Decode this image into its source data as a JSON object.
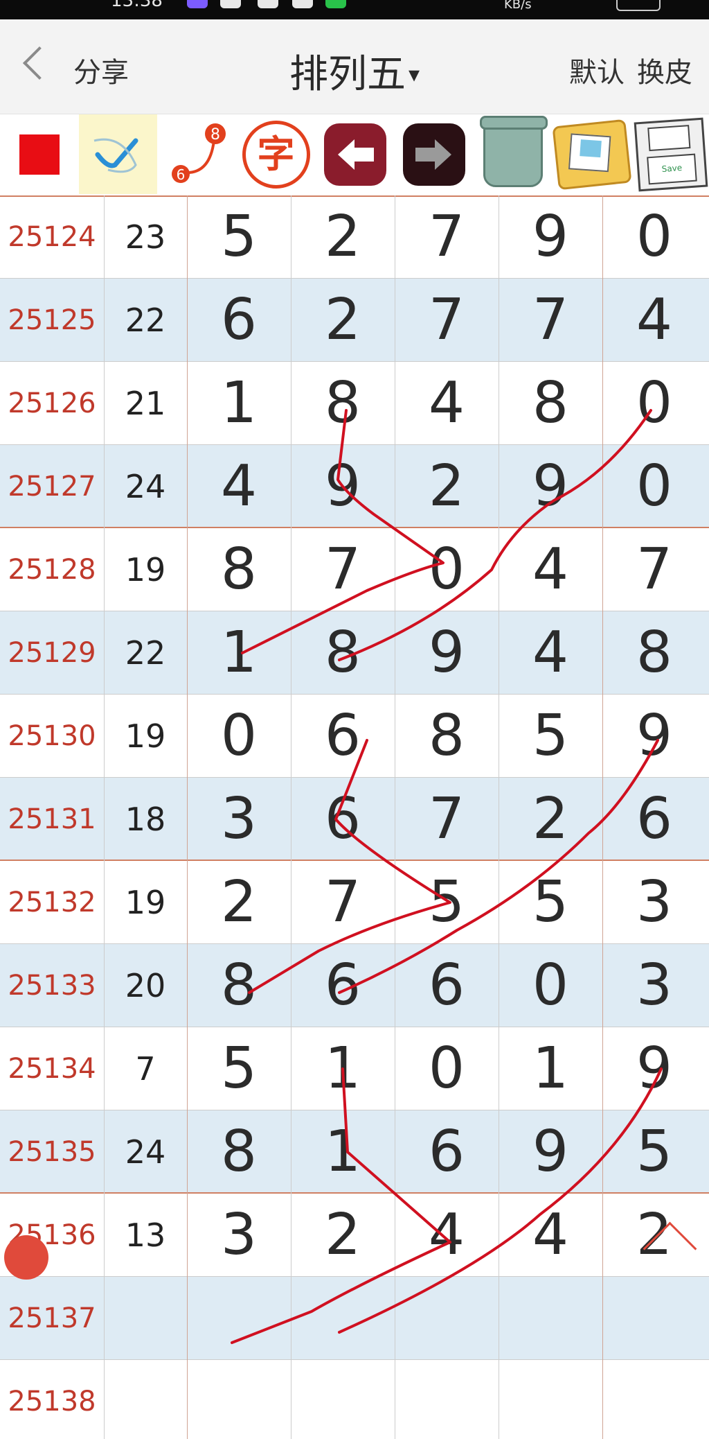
{
  "status_bar": {
    "time": "13:38",
    "network": "KB/s"
  },
  "nav": {
    "back_label": "分享",
    "title": "排列五",
    "title_caret": "▾",
    "default_label": "默认",
    "skin_label": "换皮"
  },
  "toolbar": {
    "tools": [
      {
        "icon": "red-square-icon"
      },
      {
        "icon": "check-scribble-icon"
      },
      {
        "icon": "connect-8-6-icon",
        "badge_top": "8",
        "badge_bottom": "6"
      },
      {
        "icon": "text-char-icon",
        "label": "字"
      },
      {
        "icon": "arrow-left-icon"
      },
      {
        "icon": "arrow-right-icon"
      },
      {
        "icon": "trash-icon"
      },
      {
        "icon": "folder-images-icon"
      },
      {
        "icon": "floppy-disk-icon",
        "label": "Save"
      }
    ]
  },
  "table": {
    "rows": [
      {
        "period": "25124",
        "sum": "23",
        "digits": [
          "5",
          "2",
          "7",
          "9",
          "0"
        ]
      },
      {
        "period": "25125",
        "sum": "22",
        "digits": [
          "6",
          "2",
          "7",
          "7",
          "4"
        ]
      },
      {
        "period": "25126",
        "sum": "21",
        "digits": [
          "1",
          "8",
          "4",
          "8",
          "0"
        ]
      },
      {
        "period": "25127",
        "sum": "24",
        "digits": [
          "4",
          "9",
          "2",
          "9",
          "0"
        ]
      },
      {
        "period": "25128",
        "sum": "19",
        "digits": [
          "8",
          "7",
          "0",
          "4",
          "7"
        ]
      },
      {
        "period": "25129",
        "sum": "22",
        "digits": [
          "1",
          "8",
          "9",
          "4",
          "8"
        ]
      },
      {
        "period": "25130",
        "sum": "19",
        "digits": [
          "0",
          "6",
          "8",
          "5",
          "9"
        ]
      },
      {
        "period": "25131",
        "sum": "18",
        "digits": [
          "3",
          "6",
          "7",
          "2",
          "6"
        ]
      },
      {
        "period": "25132",
        "sum": "19",
        "digits": [
          "2",
          "7",
          "5",
          "5",
          "3"
        ]
      },
      {
        "period": "25133",
        "sum": "20",
        "digits": [
          "8",
          "6",
          "6",
          "0",
          "3"
        ]
      },
      {
        "period": "25134",
        "sum": "7",
        "digits": [
          "5",
          "1",
          "0",
          "1",
          "9"
        ]
      },
      {
        "period": "25135",
        "sum": "24",
        "digits": [
          "8",
          "1",
          "6",
          "9",
          "5"
        ]
      },
      {
        "period": "25136",
        "sum": "13",
        "digits": [
          "3",
          "2",
          "4",
          "4",
          "2"
        ]
      },
      {
        "period": "25137",
        "sum": "",
        "digits": [
          "",
          "",
          "",
          "",
          ""
        ]
      },
      {
        "period": "25138",
        "sum": "",
        "digits": [
          "",
          "",
          "",
          "",
          ""
        ]
      }
    ]
  },
  "colors": {
    "period_text": "#c0392b",
    "alt_row": "#deebf4",
    "group_line": "#d07f62",
    "drawing_stroke": "#d01020"
  }
}
